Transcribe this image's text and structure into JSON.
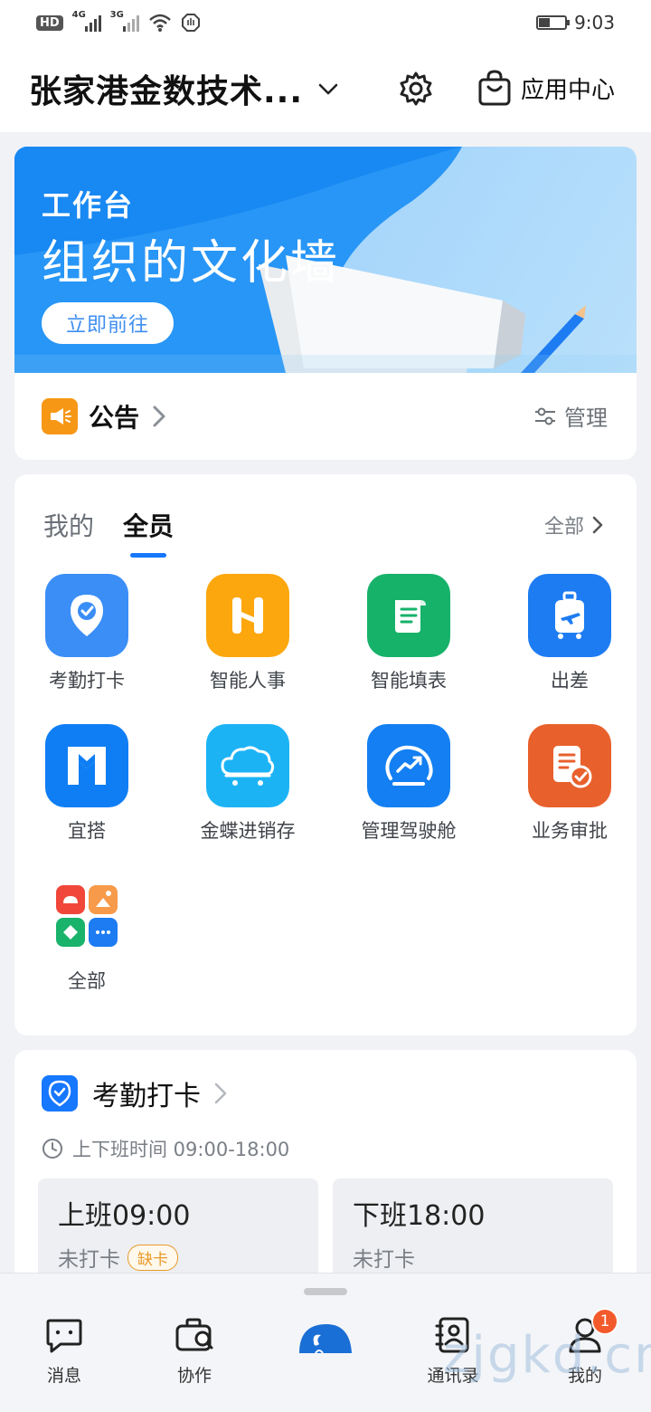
{
  "status_bar": {
    "hd": "HD",
    "sim1_type": "4G",
    "sim2_type": "3G",
    "battery_level": 0.4,
    "time": "9:03"
  },
  "header": {
    "org_name": "张家港金数技术...",
    "app_center_label": "应用中心"
  },
  "banner": {
    "subtitle": "工作台",
    "title": "组织的文化墙",
    "button_label": "立即前往",
    "colors": {
      "primary": "#1e90ff",
      "light": "#a8d7fb"
    }
  },
  "notice": {
    "label": "公告",
    "manage_label": "管理"
  },
  "apps": {
    "tabs": [
      {
        "label": "我的",
        "active": false
      },
      {
        "label": "全员",
        "active": true
      }
    ],
    "all_label": "全部",
    "items": [
      {
        "label": "考勤打卡",
        "icon": "location-check-icon",
        "color": "#3a8ef6"
      },
      {
        "label": "智能人事",
        "icon": "h-logo-icon",
        "color": "#fba70d"
      },
      {
        "label": "智能填表",
        "icon": "scroll-form-icon",
        "color": "#17b26a"
      },
      {
        "label": "出差",
        "icon": "luggage-plane-icon",
        "color": "#1d7cf2"
      },
      {
        "label": "宜搭",
        "icon": "yida-logo-icon",
        "color": "#0f7ef4"
      },
      {
        "label": "金蝶进销存",
        "icon": "cloud-cart-icon",
        "color": "#1cb3f5"
      },
      {
        "label": "管理驾驶舱",
        "icon": "dashboard-gauge-icon",
        "color": "#137ff2"
      },
      {
        "label": "业务审批",
        "icon": "document-approve-icon",
        "color": "#e8602c"
      },
      {
        "label": "全部",
        "icon": "all-apps-grid-icon",
        "color": "#ffffff"
      }
    ]
  },
  "attendance": {
    "title": "考勤打卡",
    "time_range": "上下班时间 09:00-18:00",
    "check_in": {
      "title": "上班09:00",
      "status": "未打卡",
      "badge": "缺卡"
    },
    "check_out": {
      "title": "下班18:00",
      "status": "未打卡"
    }
  },
  "bottom_nav": {
    "items": [
      {
        "label": "消息",
        "icon": "chat-bubble-icon"
      },
      {
        "label": "协作",
        "icon": "briefcase-icon"
      },
      {
        "label": "",
        "icon": "dingtalk-logo-icon"
      },
      {
        "label": "通讯录",
        "icon": "contacts-book-icon"
      },
      {
        "label": "我的",
        "icon": "user-icon",
        "badge": "1"
      }
    ]
  },
  "watermark": "zjgkd.cn"
}
